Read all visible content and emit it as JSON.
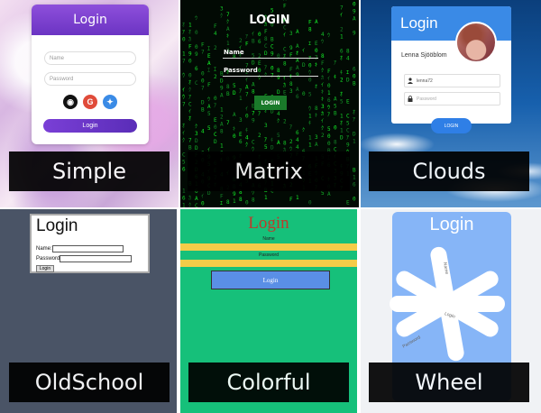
{
  "tiles": {
    "simple": {
      "caption": "Simple",
      "title": "Login",
      "name_placeholder": "Name",
      "password_placeholder": "Password",
      "social_icons": [
        "github-icon",
        "google-icon",
        "twitter-icon"
      ],
      "social_colors": [
        "#111111",
        "#e04b3a",
        "#3a8be6"
      ],
      "login_button": "Login"
    },
    "matrix": {
      "caption": "Matrix",
      "title": "LOGIN",
      "name_label": "Name",
      "password_label": "Password",
      "login_button": "LOGIN"
    },
    "clouds": {
      "caption": "Clouds",
      "title": "Login",
      "user_name": "Lenna Sjööblom",
      "username_value": "lenna72",
      "password_placeholder": "Password",
      "login_button": "LOGIN"
    },
    "oldschool": {
      "caption": "OldSchool",
      "title": "Login",
      "name_label": "Name:",
      "password_label": "Password:",
      "login_button": "Login"
    },
    "colorful": {
      "caption": "Colorful",
      "title": "Login",
      "name_label": "Name",
      "password_label": "Password",
      "login_button": "Login"
    },
    "wheel": {
      "caption": "Wheel",
      "title": "Login",
      "name_label": "Name",
      "password_label": "Password",
      "login_label": "Login"
    }
  }
}
